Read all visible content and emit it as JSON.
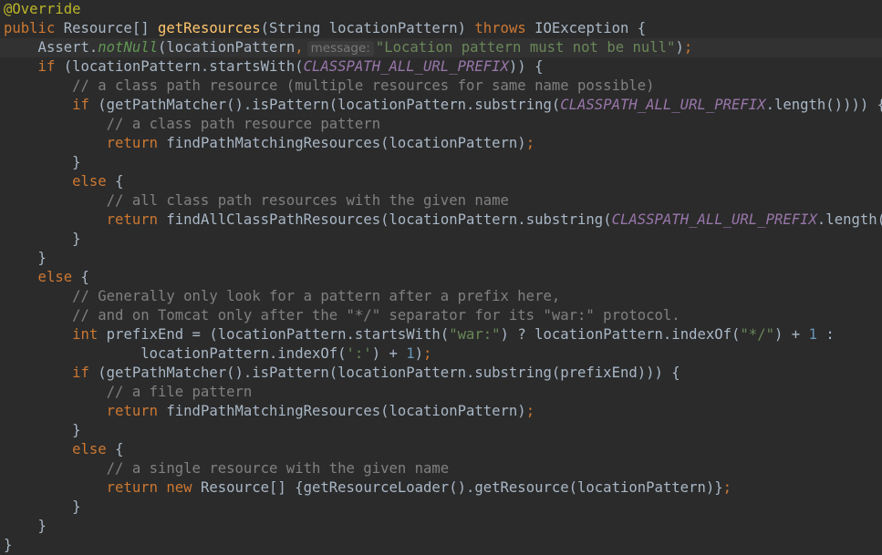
{
  "code": {
    "language": "java",
    "hint_label": "message:",
    "lines": [
      [
        {
          "c": "ann",
          "t": "@Override"
        }
      ],
      [
        {
          "c": "kw",
          "t": "public "
        },
        {
          "t": "Resource[] "
        },
        {
          "c": "fn",
          "t": "getResources"
        },
        {
          "t": "(String locationPattern) "
        },
        {
          "c": "kw",
          "t": "throws "
        },
        {
          "t": "IOException {"
        }
      ],
      [
        {
          "t": "    Assert."
        },
        {
          "c": "st",
          "t": "notNull"
        },
        {
          "t": "(locationPattern"
        },
        {
          "c": "kw",
          "t": ","
        },
        {
          "c": "hint",
          "t": "message:"
        },
        {
          "c": "str",
          "t": "\"Location pattern must not be null\""
        },
        {
          "t": ")"
        },
        {
          "c": "kw",
          "t": ";"
        }
      ],
      [
        {
          "c": "kw",
          "t": "    if "
        },
        {
          "t": "(locationPattern.startsWith("
        },
        {
          "c": "cn",
          "t": "CLASSPATH_ALL_URL_PREFIX"
        },
        {
          "t": ")) {"
        }
      ],
      [
        {
          "c": "cm",
          "t": "        // a class path resource (multiple resources for same name possible)"
        }
      ],
      [
        {
          "c": "kw",
          "t": "        if "
        },
        {
          "t": "(getPathMatcher().isPattern(locationPattern.substring("
        },
        {
          "c": "cn",
          "t": "CLASSPATH_ALL_URL_PREFIX"
        },
        {
          "t": ".length()))) {"
        }
      ],
      [
        {
          "c": "cm",
          "t": "            // a class path resource pattern"
        }
      ],
      [
        {
          "c": "kw",
          "t": "            return "
        },
        {
          "t": "findPathMatchingResources(locationPattern)"
        },
        {
          "c": "kw",
          "t": ";"
        }
      ],
      [
        {
          "t": "        }"
        }
      ],
      [
        {
          "c": "kw",
          "t": "        else "
        },
        {
          "t": "{"
        }
      ],
      [
        {
          "c": "cm",
          "t": "            // all class path resources with the given name"
        }
      ],
      [
        {
          "c": "kw",
          "t": "            return "
        },
        {
          "t": "findAllClassPathResources(locationPattern.substring("
        },
        {
          "c": "cn",
          "t": "CLASSPATH_ALL_URL_PREFIX"
        },
        {
          "t": ".length()))"
        },
        {
          "c": "kw",
          "t": ";"
        }
      ],
      [
        {
          "t": "        }"
        }
      ],
      [
        {
          "t": "    }"
        }
      ],
      [
        {
          "c": "kw",
          "t": "    else "
        },
        {
          "t": "{"
        }
      ],
      [
        {
          "c": "cm",
          "t": "        // Generally only look for a pattern after a prefix here,"
        }
      ],
      [
        {
          "c": "cm",
          "t": "        // and on Tomcat only after the \"*/\" separator for its \"war:\" protocol."
        }
      ],
      [
        {
          "c": "kw",
          "t": "        int "
        },
        {
          "t": "prefixEnd = (locationPattern.startsWith("
        },
        {
          "c": "str",
          "t": "\"war:\""
        },
        {
          "t": ") ? locationPattern.indexOf("
        },
        {
          "c": "str",
          "t": "\"*/\""
        },
        {
          "t": ") + "
        },
        {
          "c": "num",
          "t": "1"
        },
        {
          "t": " :"
        }
      ],
      [
        {
          "t": "                locationPattern.indexOf("
        },
        {
          "c": "str",
          "t": "':'"
        },
        {
          "t": ") + "
        },
        {
          "c": "num",
          "t": "1"
        },
        {
          "t": ")"
        },
        {
          "c": "kw",
          "t": ";"
        }
      ],
      [
        {
          "c": "kw",
          "t": "        if "
        },
        {
          "t": "(getPathMatcher().isPattern(locationPattern.substring(prefixEnd))) {"
        }
      ],
      [
        {
          "c": "cm",
          "t": "            // a file pattern"
        }
      ],
      [
        {
          "c": "kw",
          "t": "            return "
        },
        {
          "t": "findPathMatchingResources(locationPattern)"
        },
        {
          "c": "kw",
          "t": ";"
        }
      ],
      [
        {
          "t": "        }"
        }
      ],
      [
        {
          "c": "kw",
          "t": "        else "
        },
        {
          "t": "{"
        }
      ],
      [
        {
          "c": "cm",
          "t": "            // a single resource with the given name"
        }
      ],
      [
        {
          "c": "kw",
          "t": "            return new "
        },
        {
          "t": "Resource[] {getResourceLoader().getResource(locationPattern)}"
        },
        {
          "c": "kw",
          "t": ";"
        }
      ],
      [
        {
          "t": "        }"
        }
      ],
      [
        {
          "t": "    }"
        }
      ],
      [
        {
          "t": "}"
        }
      ]
    ]
  }
}
